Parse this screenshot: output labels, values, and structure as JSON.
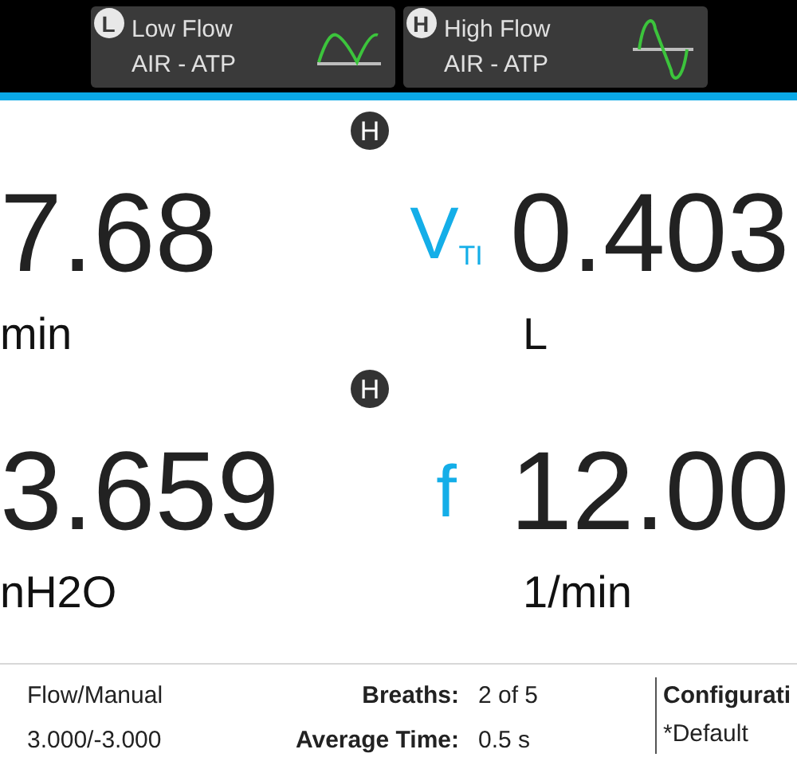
{
  "modes": [
    {
      "badge": "L",
      "title": "Low Flow",
      "subtitle": "AIR - ATP",
      "kind": "half"
    },
    {
      "badge": "H",
      "title": "High Flow",
      "subtitle": "AIR - ATP",
      "kind": "full"
    }
  ],
  "metrics": [
    {
      "badge": "H",
      "left_value": "7.68",
      "left_unit": "min",
      "symbol": "V",
      "symbol_sub": "TI",
      "right_value": "0.403",
      "right_unit": "L"
    },
    {
      "badge": "H",
      "left_value": "3.659",
      "left_unit": "nH2O",
      "symbol": "f",
      "right_value": "12.00",
      "right_unit": "1/min"
    }
  ],
  "footer": {
    "mode": "Flow/Manual",
    "range": "3.000/-3.000",
    "stats": [
      {
        "label": "Breaths:",
        "value": "2 of 5"
      },
      {
        "label": "Average Time:",
        "value": "0.5 s"
      }
    ],
    "config_title": "Configurati",
    "config_value": "*Default"
  }
}
